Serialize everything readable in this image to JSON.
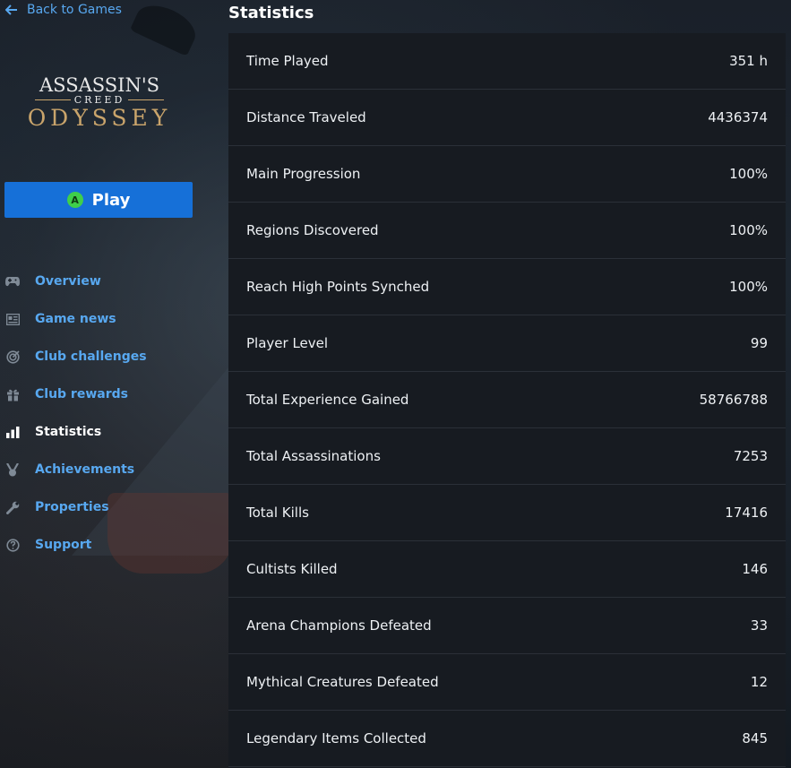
{
  "sidebar": {
    "back_label": "Back to Games",
    "logo": {
      "line1": "ASSASSIN'S",
      "line2": "CREED",
      "line3": "ODYSSEY"
    },
    "play_label": "Play",
    "play_badge": "A",
    "nav": [
      {
        "label": "Overview",
        "icon": "gamepad-icon",
        "active": false
      },
      {
        "label": "Game news",
        "icon": "newspaper-icon",
        "active": false
      },
      {
        "label": "Club challenges",
        "icon": "target-icon",
        "active": false
      },
      {
        "label": "Club rewards",
        "icon": "gift-icon",
        "active": false
      },
      {
        "label": "Statistics",
        "icon": "bar-chart-icon",
        "active": true
      },
      {
        "label": "Achievements",
        "icon": "medal-icon",
        "active": false
      },
      {
        "label": "Properties",
        "icon": "wrench-icon",
        "active": false
      },
      {
        "label": "Support",
        "icon": "help-circle-icon",
        "active": false
      }
    ]
  },
  "main": {
    "title": "Statistics",
    "stats": [
      {
        "label": "Time Played",
        "value": "351 h"
      },
      {
        "label": "Distance Traveled",
        "value": "4436374"
      },
      {
        "label": "Main Progression",
        "value": "100%"
      },
      {
        "label": "Regions Discovered",
        "value": "100%"
      },
      {
        "label": "Reach High Points Synched",
        "value": "100%"
      },
      {
        "label": "Player Level",
        "value": "99"
      },
      {
        "label": "Total Experience Gained",
        "value": "58766788"
      },
      {
        "label": "Total Assassinations",
        "value": "7253"
      },
      {
        "label": "Total Kills",
        "value": "17416"
      },
      {
        "label": "Cultists Killed",
        "value": "146"
      },
      {
        "label": "Arena Champions Defeated",
        "value": "33"
      },
      {
        "label": "Mythical Creatures Defeated",
        "value": "12"
      },
      {
        "label": "Legendary Items Collected",
        "value": "845"
      }
    ]
  },
  "colors": {
    "accent_link": "#58a8f0",
    "play_button": "#1670d8",
    "play_badge": "#3fcf4a",
    "logo_gold": "#c9a46b",
    "panel_bg": "#171b21"
  }
}
